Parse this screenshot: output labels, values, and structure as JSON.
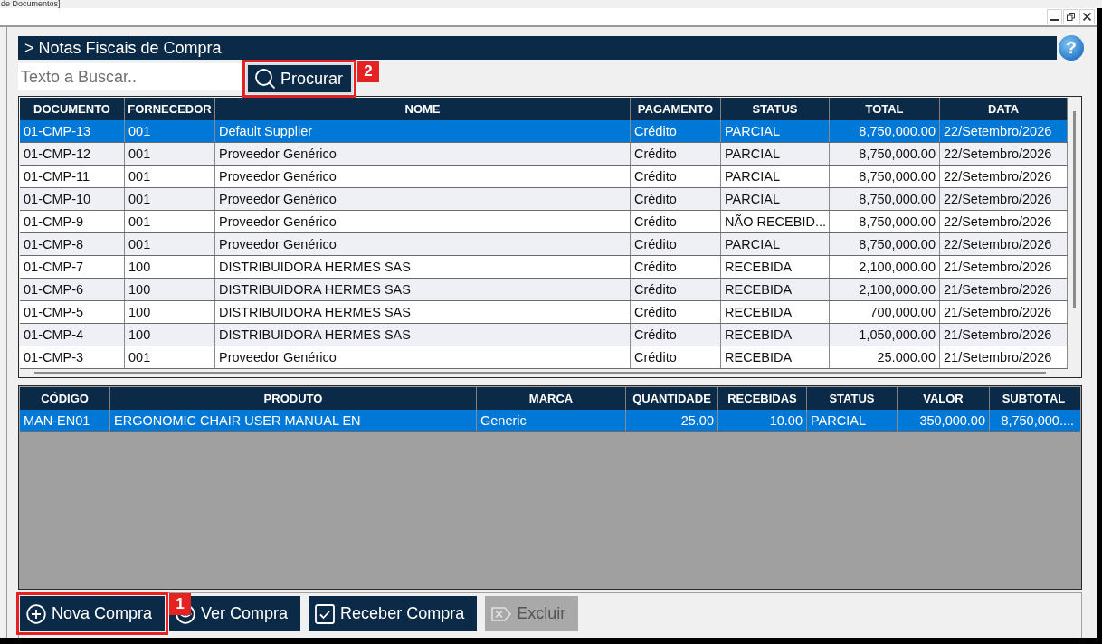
{
  "window": {
    "title": "de Documentos]"
  },
  "panel": {
    "title": "> Notas Fiscais de Compra",
    "help_label": "?"
  },
  "search": {
    "placeholder": "Texto a Buscar..",
    "button": {
      "label": "Procurar",
      "callout": "2"
    }
  },
  "invoices": {
    "columns": [
      "DOCUMENTO",
      "FORNECEDOR",
      "NOME",
      "PAGAMENTO",
      "STATUS",
      "TOTAL",
      "DATA"
    ],
    "rows": [
      {
        "selected": true,
        "cells": [
          "01-CMP-13",
          "001",
          "Default Supplier",
          "Crédito",
          "PARCIAL",
          "8,750,000.00",
          "22/Setembro/2026"
        ]
      },
      {
        "selected": false,
        "cells": [
          "01-CMP-12",
          "001",
          "Proveedor Genérico",
          "Crédito",
          "PARCIAL",
          "8,750,000.00",
          "22/Setembro/2026"
        ]
      },
      {
        "selected": false,
        "cells": [
          "01-CMP-11",
          "001",
          "Proveedor Genérico",
          "Crédito",
          "PARCIAL",
          "8,750,000.00",
          "22/Setembro/2026"
        ]
      },
      {
        "selected": false,
        "cells": [
          "01-CMP-10",
          "001",
          "Proveedor Genérico",
          "Crédito",
          "PARCIAL",
          "8,750,000.00",
          "22/Setembro/2026"
        ]
      },
      {
        "selected": false,
        "cells": [
          "01-CMP-9",
          "001",
          "Proveedor Genérico",
          "Crédito",
          "NÃO RECEBID...",
          "8,750,000.00",
          "22/Setembro/2026"
        ]
      },
      {
        "selected": false,
        "cells": [
          "01-CMP-8",
          "001",
          "Proveedor Genérico",
          "Crédito",
          "PARCIAL",
          "8,750,000.00",
          "22/Setembro/2026"
        ]
      },
      {
        "selected": false,
        "cells": [
          "01-CMP-7",
          "100",
          "DISTRIBUIDORA HERMES SAS",
          "Crédito",
          "RECEBIDA",
          "2,100,000.00",
          "21/Setembro/2026"
        ]
      },
      {
        "selected": false,
        "cells": [
          "01-CMP-6",
          "100",
          "DISTRIBUIDORA HERMES SAS",
          "Crédito",
          "RECEBIDA",
          "2,100,000.00",
          "21/Setembro/2026"
        ]
      },
      {
        "selected": false,
        "cells": [
          "01-CMP-5",
          "100",
          "DISTRIBUIDORA HERMES SAS",
          "Crédito",
          "RECEBIDA",
          "700,000.00",
          "21/Setembro/2026"
        ]
      },
      {
        "selected": false,
        "cells": [
          "01-CMP-4",
          "100",
          "DISTRIBUIDORA HERMES SAS",
          "Crédito",
          "RECEBIDA",
          "1,050,000.00",
          "21/Setembro/2026"
        ]
      },
      {
        "selected": false,
        "cells": [
          "01-CMP-3",
          "001",
          "Proveedor Genérico",
          "Crédito",
          "RECEBIDA",
          "25.000.00",
          "21/Setembro/2026"
        ]
      }
    ]
  },
  "items": {
    "columns": [
      "CÓDIGO",
      "PRODUTO",
      "MARCA",
      "QUANTIDADE",
      "RECEBIDAS",
      "STATUS",
      "VALOR",
      "SUBTOTAL"
    ],
    "rows": [
      {
        "selected": true,
        "cells": [
          "MAN-EN01",
          "ERGONOMIC CHAIR USER MANUAL EN",
          "Generic",
          "25.00",
          "10.00",
          "PARCIAL",
          "350,000.00",
          "8,750,000...."
        ]
      }
    ]
  },
  "actions": [
    {
      "kind": "add",
      "label": "Nova Compra",
      "disabled": false,
      "callout": "1"
    },
    {
      "kind": "view",
      "label": "Ver Compra",
      "disabled": false
    },
    {
      "kind": "receive",
      "label": "Receber Compra",
      "disabled": false
    },
    {
      "kind": "delete",
      "label": "Excluir",
      "disabled": true
    }
  ]
}
